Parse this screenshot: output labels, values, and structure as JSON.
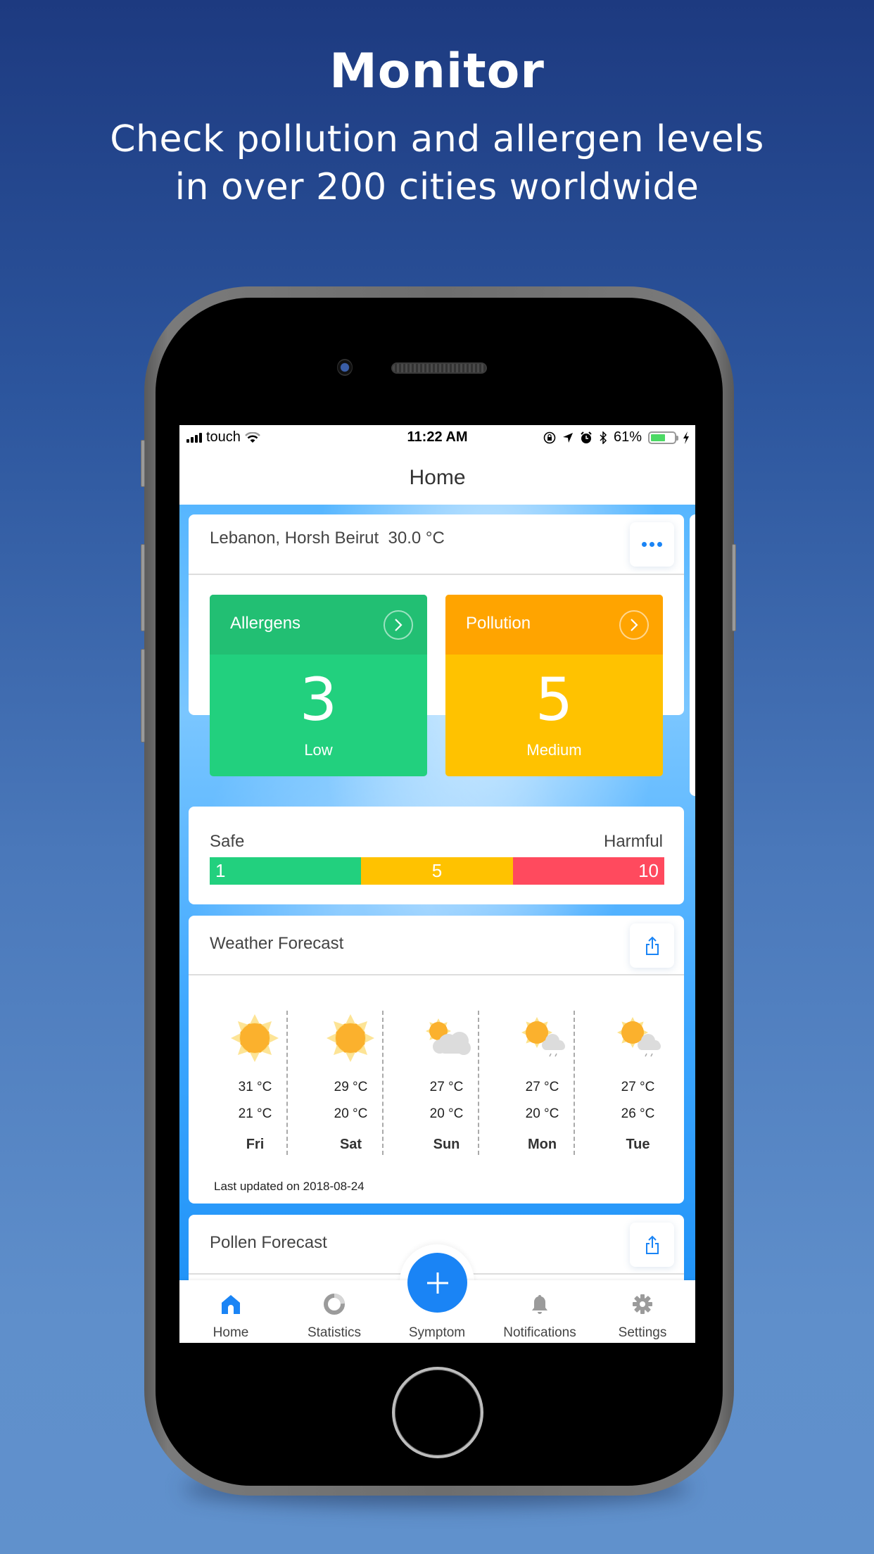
{
  "promo": {
    "title": "Monitor",
    "subtitle_line1": "Check pollution and allergen levels",
    "subtitle_line2": "in over 200 cities worldwide"
  },
  "status_bar": {
    "carrier": "touch",
    "time": "11:22 AM",
    "battery_percent": "61%",
    "battery_level": 0.61,
    "icons": [
      "signal-icon",
      "wifi-icon",
      "orientation-lock-icon",
      "location-icon",
      "alarm-icon",
      "bluetooth-icon",
      "battery-icon",
      "charging-icon"
    ]
  },
  "nav": {
    "title": "Home"
  },
  "location_card": {
    "location": "Lebanon, Horsh Beirut",
    "temperature": "30.0 °C",
    "more_icon": "ellipsis-icon",
    "tiles": [
      {
        "label": "Allergens",
        "value": "3",
        "level": "Low",
        "head_color": "#22bf73",
        "body_color": "#22d07e"
      },
      {
        "label": "Pollution",
        "value": "5",
        "level": "Medium",
        "head_color": "#ffa400",
        "body_color": "#ffc200"
      }
    ]
  },
  "scale_card": {
    "left_label": "Safe",
    "right_label": "Harmful",
    "segments": [
      {
        "value": "1",
        "color": "#22d07e",
        "align": "left"
      },
      {
        "value": "5",
        "color": "#ffc200",
        "align": "center"
      },
      {
        "value": "10",
        "color": "#ff4a5e",
        "align": "right"
      }
    ]
  },
  "weather_card": {
    "title": "Weather Forecast",
    "share_icon": "share-icon",
    "days": [
      {
        "day": "Fri",
        "high": "31 °C",
        "low": "21 °C",
        "icon": "sunny"
      },
      {
        "day": "Sat",
        "high": "29 °C",
        "low": "20 °C",
        "icon": "sunny"
      },
      {
        "day": "Sun",
        "high": "27 °C",
        "low": "20 °C",
        "icon": "partly-cloudy"
      },
      {
        "day": "Mon",
        "high": "27 °C",
        "low": "20 °C",
        "icon": "sun-rain"
      },
      {
        "day": "Tue",
        "high": "27 °C",
        "low": "26 °C",
        "icon": "sun-rain"
      }
    ],
    "last_updated": "Last updated on 2018-08-24"
  },
  "pollen_card": {
    "title": "Pollen Forecast",
    "share_icon": "share-icon"
  },
  "tab_bar": {
    "active": "Home",
    "active_color": "#1a84f5",
    "inactive_color": "#9b9b9b",
    "items": [
      {
        "label": "Home",
        "icon": "home-icon"
      },
      {
        "label": "Statistics",
        "icon": "statistics-icon"
      },
      {
        "label": "Symptom",
        "icon": "plus-icon"
      },
      {
        "label": "Notifications",
        "icon": "bell-icon"
      },
      {
        "label": "Settings",
        "icon": "gear-icon"
      }
    ]
  }
}
